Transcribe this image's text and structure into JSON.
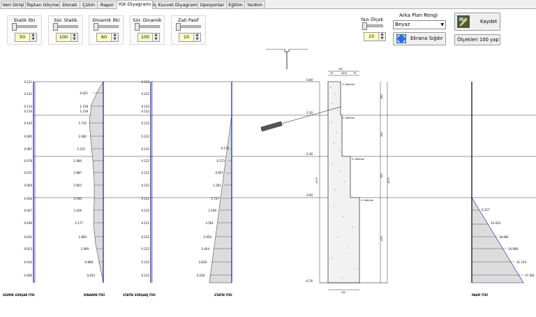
{
  "tabs": [
    "Veri Girişi",
    "Toptan Göçme",
    "Donatı",
    "Çizim",
    "Rapor",
    "Yük Diyagramı",
    "İç Kuvvet Diyagramı",
    "Opsiyonlar",
    "Eğitim",
    "Yardım"
  ],
  "active_tab": "Yük Diyagramı",
  "controls": {
    "statik_itki": {
      "label": "Statik İtki",
      "value": "50"
    },
    "sur_statik": {
      "label": "Sür. Statik",
      "value": "100"
    },
    "dinamik_itki": {
      "label": "Dinamik İtki",
      "value": "60"
    },
    "sur_dinamik": {
      "label": "Sür. Dinamik",
      "value": "100"
    },
    "zati_pasif": {
      "label": "Zati Pasif",
      "value": "10"
    },
    "yazi_olcek": {
      "label": "Yazı Ölçek",
      "value": "10"
    },
    "arka_plan": {
      "label": "Arka Plan Rengi",
      "value": "Beyaz"
    },
    "ekrana_sigdir": "Ekrana Sığdır",
    "kaydet": "Kaydet",
    "olcekleri": "Ölçekleri 100 yap"
  },
  "left_values": [
    "0.121",
    "0.122",
    "0.114",
    "0.110",
    "0.103",
    "0.095",
    "0.087",
    "0.078",
    "0.071",
    "0.064",
    "0.056",
    "0.047",
    "0.039",
    "0.031",
    "0.023",
    "0.014",
    "0.006"
  ],
  "dinamik_values": [
    "0.621",
    "1.158",
    "1.318",
    "1.732",
    "2.082",
    "2.215",
    "2.480",
    "2.887",
    "2.855",
    "2.540",
    "2.426",
    "2.177",
    "1.860",
    "1.489",
    "0.888",
    "0.632"
  ],
  "static_sur_values": [
    "0.122",
    "0.122",
    "0.122",
    "0.122",
    "0.122",
    "0.122",
    "0.122",
    "0.122",
    "0.122",
    "0.122",
    "0.122",
    "0.122",
    "0.122",
    "0.122",
    "0.122",
    "0.122",
    "0.122"
  ],
  "statik_values": [
    "0.176",
    "0.573",
    "0.957",
    "1.261",
    "1.727",
    "2.190",
    "2.561",
    "2.950",
    "3.404",
    "3.816",
    "4.228"
  ],
  "pasif_values": [
    "6.227",
    "12.454",
    "18.681",
    "24.908",
    "31.134",
    "37.361"
  ],
  "elevations": [
    "0.00",
    "-1.30",
    "-2.40",
    "-3.60",
    "-6.76"
  ],
  "layers": [
    "1. Katman",
    "2. Katman",
    "3. Katman",
    "4. Katman"
  ],
  "dims": {
    "top": "200",
    "top_parts": [
      "70",
      "40/5",
      "70"
    ],
    "bottom": "320",
    "side_total": "1075",
    "segments": [
      "280",
      "300",
      "350",
      "415"
    ]
  },
  "captions": {
    "sismik": "SİSMİK SÜRŞAR İTKİ",
    "dinamik": "DİNAMİK İTKİ",
    "statik_sur": "STATİK SÜRŞARJ İTKİ",
    "statik": "STATİK İTKİ",
    "pasif": "PASİF İTKİ"
  }
}
